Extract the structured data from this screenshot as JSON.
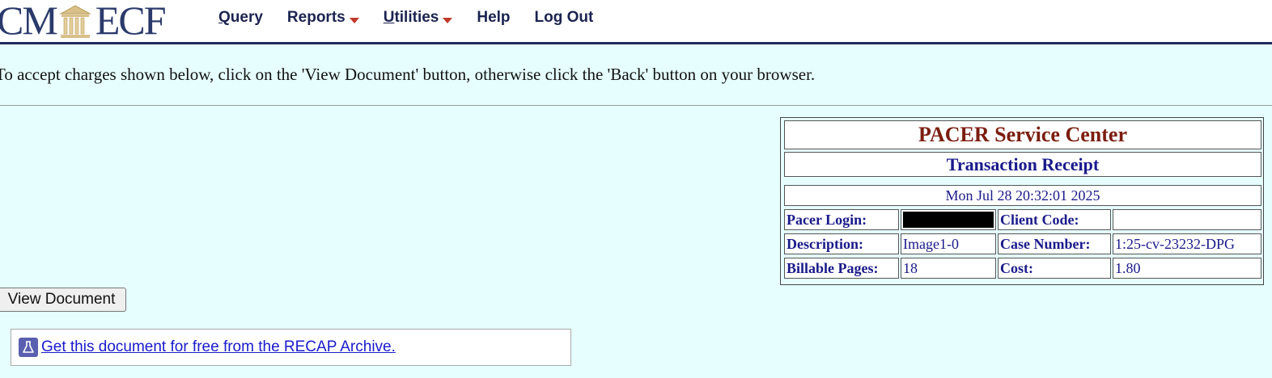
{
  "header": {
    "logo_left": "CM",
    "logo_right": "ECF",
    "nav": [
      {
        "first": "Q",
        "rest": "uery",
        "has_caret": false
      },
      {
        "first": "",
        "rest": "Reports",
        "has_caret": true
      },
      {
        "first": "U",
        "rest": "tilities",
        "has_caret": true
      },
      {
        "first": "",
        "rest": "Help",
        "has_caret": false
      },
      {
        "first": "",
        "rest": "Log Out",
        "has_caret": false
      }
    ]
  },
  "instruction": "To accept charges shown below, click on the 'View Document' button, otherwise click the 'Back' button on your browser.",
  "receipt": {
    "title": "PACER Service Center",
    "subtitle": "Transaction Receipt",
    "datetime": "Mon Jul 28 20:32:01 2025",
    "rows": [
      {
        "label1": "Pacer Login:",
        "value1": "",
        "label2": "Client Code:",
        "value2": ""
      },
      {
        "label1": "Description:",
        "value1": "Image1-0",
        "label2": "Case Number:",
        "value2": "1:25-cv-23232-DPG"
      },
      {
        "label1": "Billable Pages:",
        "value1": "18",
        "label2": "Cost:",
        "value2": "1.80"
      }
    ]
  },
  "view_button": "View Document",
  "recap_link": "Get this document for free from the RECAP Archive.",
  "colors": {
    "background": "#e6fffe",
    "title_red": "#7b1e10",
    "navy": "#1a1a8c",
    "caret": "#c0392b"
  }
}
